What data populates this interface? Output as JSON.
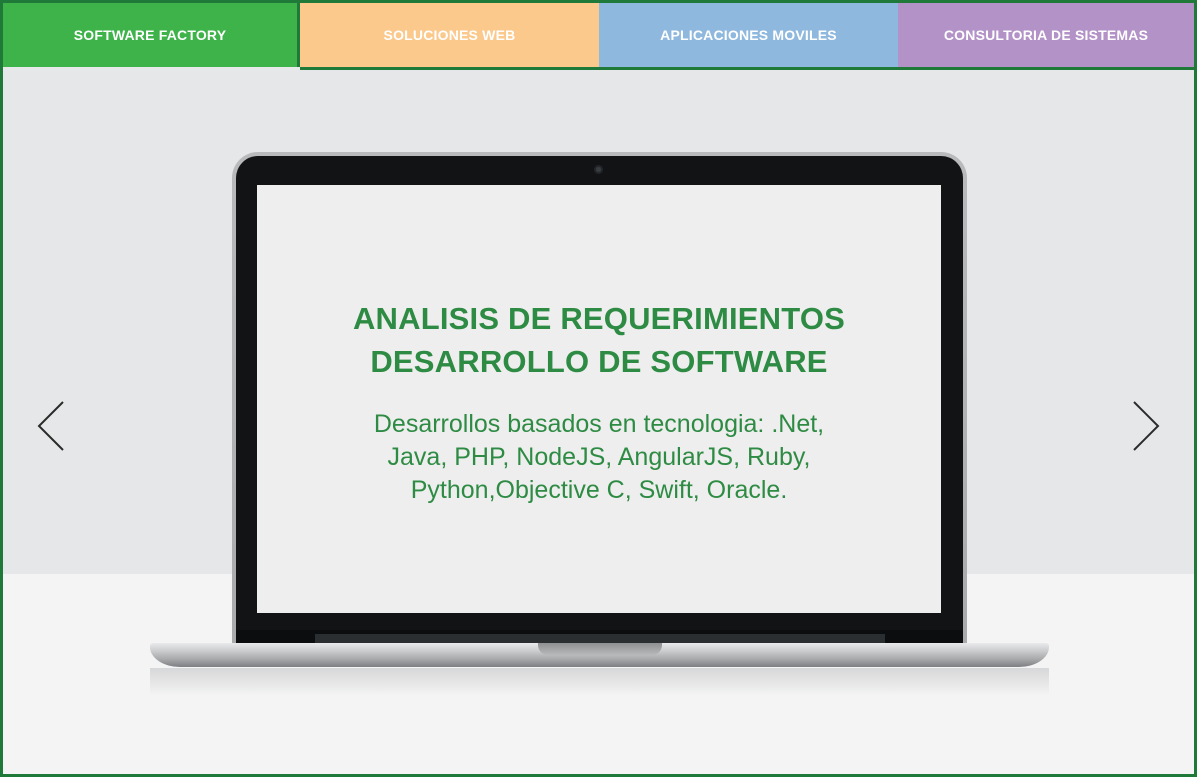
{
  "nav": {
    "tabs": [
      {
        "label": "SOFTWARE FACTORY",
        "active": true,
        "color": "#3db34a"
      },
      {
        "label": "SOLUCIONES WEB",
        "active": false,
        "color": "#fbc98c"
      },
      {
        "label": "APLICACIONES MOVILES",
        "active": false,
        "color": "#8fb8de"
      },
      {
        "label": "CONSULTORIA DE SISTEMAS",
        "active": false,
        "color": "#b392c8"
      }
    ]
  },
  "slide": {
    "headline_line1": "ANALISIS DE REQUERIMIENTOS",
    "headline_line2": "DESARROLLO DE SOFTWARE",
    "body_line1": "Desarrollos basados en tecnologia: .Net,",
    "body_line2": "Java, PHP, NodeJS, AngularJS, Ruby,",
    "body_line3": "Python,Objective C, Swift, Oracle.",
    "text_color": "#2e8b44"
  },
  "controls": {
    "prev_icon": "chevron-left-icon",
    "next_icon": "chevron-right-icon"
  },
  "theme": {
    "border_color": "#1f7a3a"
  }
}
